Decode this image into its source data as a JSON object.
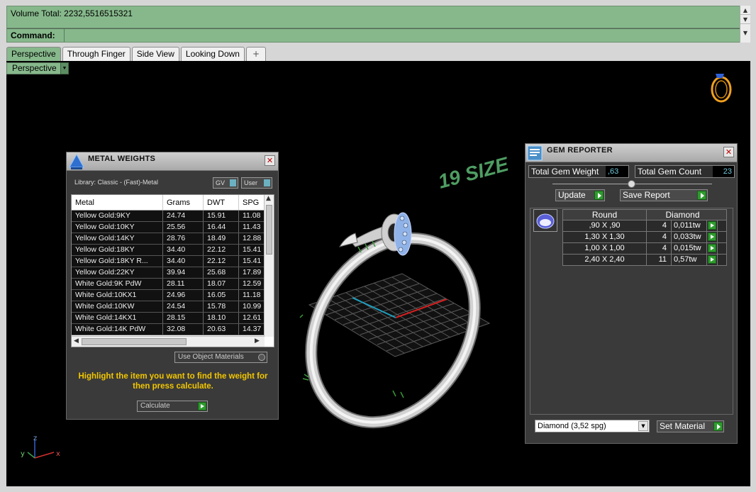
{
  "command_area": {
    "history_text": "Volume Total: 2232,5516515321",
    "command_label": "Command:",
    "scroll_up": "▲",
    "scroll_down": "▼",
    "scroll_down2": "▼"
  },
  "tabs": [
    {
      "label": "Perspective",
      "active": true
    },
    {
      "label": "Through Finger"
    },
    {
      "label": "Side View"
    },
    {
      "label": "Looking Down"
    },
    {
      "label": "+"
    }
  ],
  "viewport": {
    "view_label": "Perspective",
    "dropdown_glyph": "▼",
    "size_text": "19 SIZE",
    "axis_labels": {
      "z": "z",
      "y": "y",
      "x": "x"
    }
  },
  "metal_weights": {
    "title": "METAL WEIGHTS",
    "close": "✕",
    "library": "Library: Classic - (Fast)-Metal",
    "toggle_gv": "GV",
    "toggle_user": "User",
    "columns": [
      "Metal",
      "Grams",
      "DWT",
      "SPG"
    ],
    "rows": [
      [
        "Yellow Gold:9KY",
        "24.74",
        "15.91",
        "11.08"
      ],
      [
        "Yellow Gold:10KY",
        "25.56",
        "16.44",
        "11.43"
      ],
      [
        "Yellow Gold:14KY",
        "28.76",
        "18.49",
        "12.88"
      ],
      [
        "Yellow Gold:18KY",
        "34.40",
        "22.12",
        "15.41"
      ],
      [
        "Yellow Gold:18KY R...",
        "34.40",
        "22.12",
        "15.41"
      ],
      [
        "Yellow Gold:22KY",
        "39.94",
        "25.68",
        "17.89"
      ],
      [
        "White Gold:9K PdW",
        "28.11",
        "18.07",
        "12.59"
      ],
      [
        "White Gold:10KX1",
        "24.96",
        "16.05",
        "11.18"
      ],
      [
        "White Gold:10KW",
        "24.54",
        "15.78",
        "10.99"
      ],
      [
        "White Gold:14KX1",
        "28.15",
        "18.10",
        "12.61"
      ],
      [
        "White Gold:14K PdW",
        "32.08",
        "20.63",
        "14.37"
      ]
    ],
    "use_object_materials": "Use Object Materials",
    "hint": "Highlight the item you want to find the weight for then press calculate.",
    "calculate": "Calculate",
    "scroll_up": "▲",
    "scroll_left": "◀",
    "scroll_right": "▶"
  },
  "gem_reporter": {
    "title": "GEM REPORTER",
    "close": "✕",
    "total_weight_label": "Total Gem Weight",
    "total_weight_value": ",63",
    "total_count_label": "Total Gem Count",
    "total_count_value": "23",
    "update": "Update",
    "save_report": "Save Report",
    "columns": [
      "Round",
      "Diamond"
    ],
    "rows": [
      [
        ",90 X ,90",
        "4",
        "0,011tw"
      ],
      [
        "1,30 X 1,30",
        "4",
        "0,033tw"
      ],
      [
        "1,00 X 1,00",
        "4",
        "0,015tw"
      ],
      [
        "2,40 X 2,40",
        "11",
        "0,57tw"
      ]
    ],
    "material_select": "Diamond      (3,52 spg)",
    "dropdown_glyph": "▼",
    "set_material": "Set Material"
  },
  "colors": {
    "command_green": "#86b88b",
    "hint_yellow": "#f2c600",
    "value_cyan": "#6fc7d9",
    "go_green": "#2e9c2e",
    "size_text": "#5ea96b"
  }
}
